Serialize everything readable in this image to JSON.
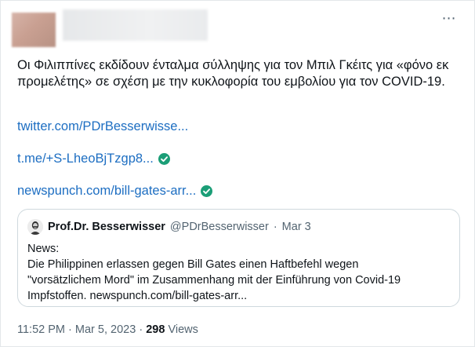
{
  "tweet": {
    "text": "Οι Φιλιππίνες εκδίδουν ένταλμα σύλληψης για τον Μπιλ Γκέιτς για «φόνο εκ προμελέτης» σε σχέση με την κυκλοφορία του εμβολίου για τον COVID-19.",
    "links": [
      "twitter.com/PDrBesserwisse...",
      "t.me/+S-LheoBjTzgp8...",
      "newspunch.com/bill-gates-arr..."
    ],
    "more_icon": "⋯"
  },
  "quote": {
    "name": "Prof.Dr. Besserwisser",
    "handle": "@PDrBesserwisser",
    "dot": "·",
    "date": "Mar 3",
    "line1": "News:",
    "line2": "Die Philippinen erlassen gegen Bill Gates einen Haftbefehl wegen",
    "line3": "\"vorsätzlichem Mord\" im Zusammenhang mit der Einführung von Covid-19",
    "line4": "Impfstoffen. newspunch.com/bill-gates-arr..."
  },
  "meta": {
    "time": "11:52 PM",
    "dot1": "·",
    "date": "Mar 5, 2023",
    "dot2": "·",
    "views_count": "298",
    "views_label": "Views"
  },
  "colors": {
    "link": "#1d6ec2",
    "check": "#1b9e77",
    "muted": "#536471"
  }
}
